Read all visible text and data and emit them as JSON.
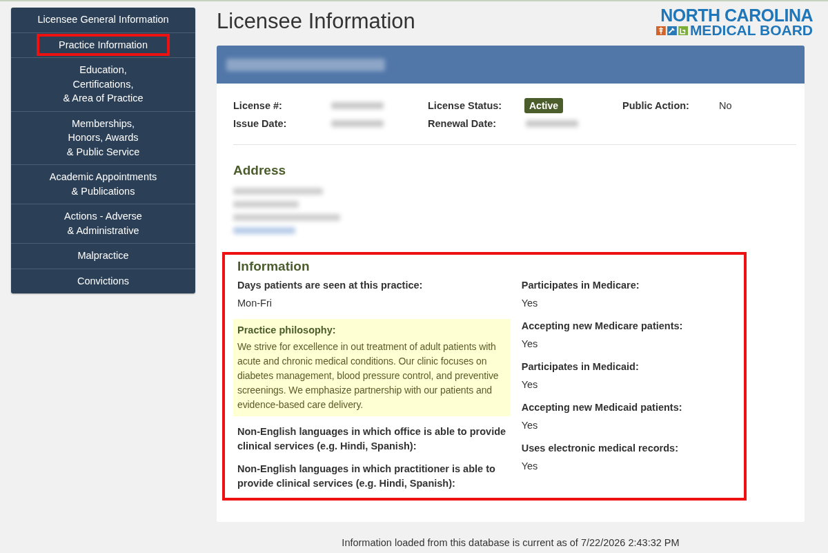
{
  "sidebar": {
    "items": [
      {
        "label": "Licensee General Information",
        "highlighted": false
      },
      {
        "label": "Practice Information",
        "highlighted": true
      },
      {
        "label": "Education,\nCertifications,\n& Area of Practice",
        "highlighted": false
      },
      {
        "label": "Memberships,\nHonors, Awards\n& Public Service",
        "highlighted": false
      },
      {
        "label": "Academic Appointments\n& Publications",
        "highlighted": false
      },
      {
        "label": "Actions - Adverse\n& Administrative",
        "highlighted": false
      },
      {
        "label": "Malpractice",
        "highlighted": false
      },
      {
        "label": "Convictions",
        "highlighted": false
      }
    ]
  },
  "page_title": "Licensee Information",
  "logo": {
    "line_1": "NORTH CAROLINA",
    "line_2": "MEDICAL BOARD"
  },
  "header": {
    "name_redacted": true
  },
  "summary": [
    {
      "label": "License #:",
      "kind": "redacted"
    },
    {
      "label": "License Status:",
      "kind": "badge",
      "value": "Active"
    },
    {
      "label": "Public Action:",
      "kind": "text",
      "value": "No"
    },
    {
      "label": "Issue Date:",
      "kind": "redacted"
    },
    {
      "label": "Renewal Date:",
      "kind": "redacted"
    }
  ],
  "address": {
    "heading": "Address",
    "lines": [
      {
        "kind": "redacted-text"
      },
      {
        "kind": "redacted-text"
      },
      {
        "kind": "redacted-text"
      },
      {
        "kind": "redacted-link"
      }
    ]
  },
  "information": {
    "heading": "Information",
    "highlighted": true,
    "left": [
      {
        "kind": "plain",
        "label": "Days patients are seen at this practice:",
        "value": "Mon-Fri"
      },
      {
        "kind": "note",
        "label": "Practice philosophy:",
        "value": "We strive for excellence in out treatment of adult patients with acute and chronic medical conditions. Our clinic focuses on diabetes management, blood pressure control, and preventive screenings. We emphasize partnership with our patients and evidence-based care delivery."
      },
      {
        "kind": "plain",
        "label": "Non-English languages in which office is able to provide clinical services (e.g. Hindi, Spanish):"
      },
      {
        "kind": "plain",
        "label": "Non-English languages in which practitioner is able to provide clinical services (e.g. Hindi, Spanish):"
      }
    ],
    "right": [
      {
        "label": "Participates in Medicare:",
        "value": "Yes"
      },
      {
        "label": "Accepting new Medicare patients:",
        "value": "Yes"
      },
      {
        "label": "Participates in Medicaid:",
        "value": "Yes"
      },
      {
        "label": "Accepting new Medicaid patients:",
        "value": "Yes"
      },
      {
        "label": "Uses electronic medical records:",
        "value": "Yes"
      }
    ]
  },
  "footer": "Information loaded from this database is current as of 7/22/2026 2:43:32 PM"
}
